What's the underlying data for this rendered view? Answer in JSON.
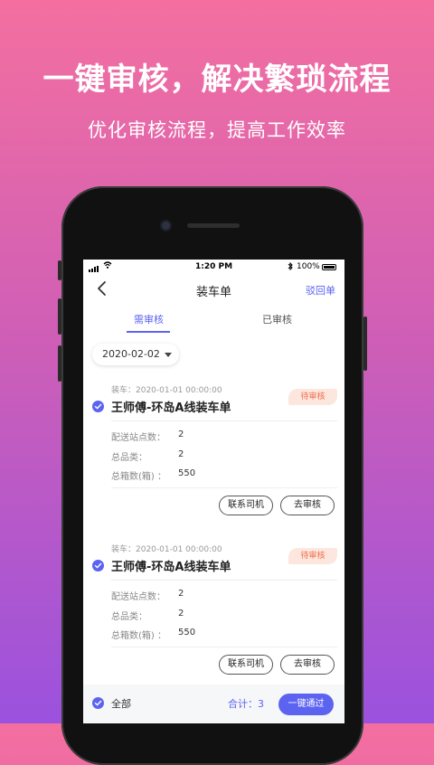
{
  "promo": {
    "title": "一键审核，解决繁琐流程",
    "subtitle": "优化审核流程，提高工作效率"
  },
  "status_bar": {
    "time": "1:20 PM",
    "battery": "100%",
    "icons": [
      "signal-icon",
      "wifi-icon",
      "bluetooth-icon",
      "battery-icon"
    ]
  },
  "nav": {
    "title": "装车单",
    "reject_label": "驳回单",
    "back_icon": "chevron-left-icon"
  },
  "tabs": [
    {
      "label": "需审核",
      "active": true
    },
    {
      "label": "已审核",
      "active": false
    }
  ],
  "filter": {
    "date": "2020-02-02"
  },
  "orders": [
    {
      "date": "装车：2020-01-01  00:00:00",
      "badge": "待审核",
      "title": "王师傅-环岛A线装车单",
      "checked": true,
      "rows": [
        {
          "label": "配送站点数：",
          "value": "2"
        },
        {
          "label": "总品类：",
          "value": "2"
        },
        {
          "label": "总箱数(箱) ：",
          "value": "550"
        }
      ],
      "contact_label": "联系司机",
      "review_label": "去审核"
    },
    {
      "date": "装车：2020-01-01  00:00:00",
      "badge": "待审核",
      "title": "王师傅-环岛A线装车单",
      "checked": true,
      "rows": [
        {
          "label": "配送站点数：",
          "value": "2"
        },
        {
          "label": "总品类：",
          "value": "2"
        },
        {
          "label": "总箱数(箱) ：",
          "value": "550"
        }
      ],
      "contact_label": "联系司机",
      "review_label": "去审核"
    }
  ],
  "footer": {
    "select_all_label": "全部",
    "total_label": "合计：3",
    "approve_label": "一键通过"
  },
  "colors": {
    "accent": "#5b63f0",
    "badge_bg": "#fde6dd",
    "badge_text": "#f07050",
    "bg_top": "#f46fa0",
    "bg_bottom": "#9b52de"
  }
}
